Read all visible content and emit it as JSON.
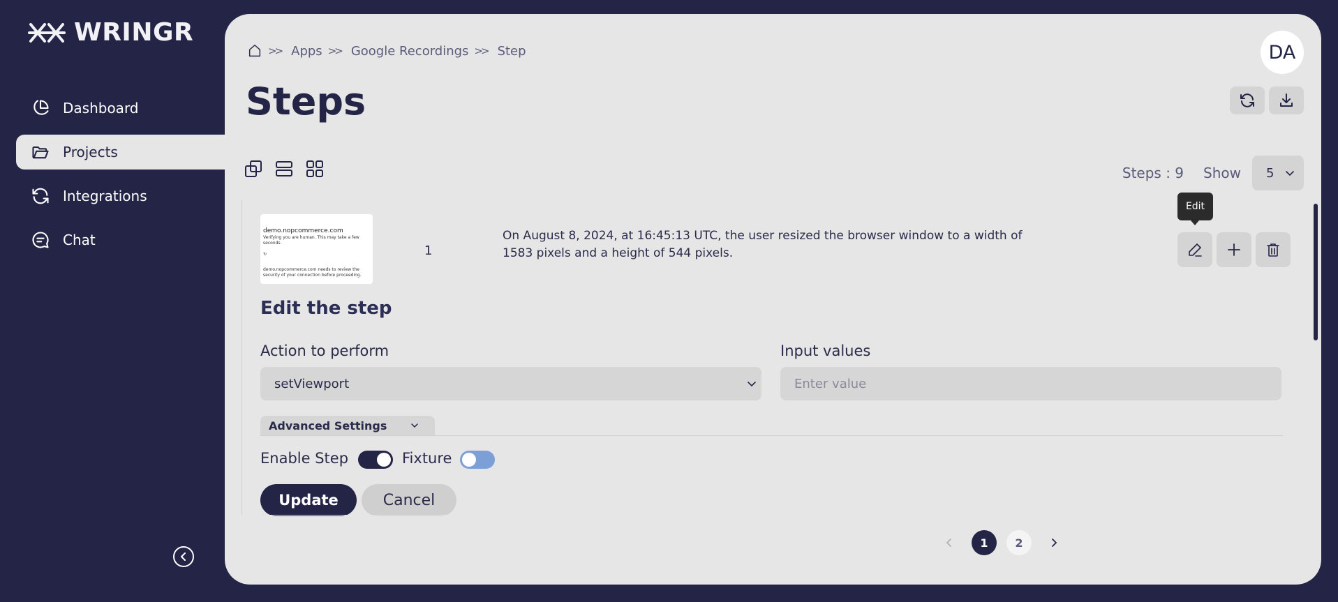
{
  "brand": {
    "name": "WRINGR"
  },
  "sidebar": {
    "items": [
      {
        "label": "Dashboard",
        "icon": "pie-chart-icon",
        "active": false
      },
      {
        "label": "Projects",
        "icon": "folder-icon",
        "active": true
      },
      {
        "label": "Integrations",
        "icon": "refresh-icon",
        "active": false
      },
      {
        "label": "Chat",
        "icon": "chat-bubble-icon",
        "active": false
      }
    ],
    "collapse_icon": "chevron-left-circle-icon"
  },
  "header": {
    "breadcrumb": [
      "Apps",
      "Google Recordings",
      "Step"
    ],
    "avatar": "DA",
    "title": "Steps"
  },
  "toolbar": {
    "steps_count": "Steps : 9",
    "show_label": "Show",
    "show_value": "5"
  },
  "step": {
    "number": "1",
    "thumbnail": {
      "site": "demo.nopcommerce.com",
      "line1": "Verifying you are human. This may take a few seconds.",
      "line2": "demo.nopcommerce.com needs to review the security of your connection before proceeding."
    },
    "description": "On August 8, 2024, at 16:45:13 UTC, the user resized the browser window to a width of 1583 pixels and a height of 544 pixels.",
    "tooltip": "Edit"
  },
  "edit_form": {
    "title": "Edit the step",
    "action_label": "Action to perform",
    "action_value": "setViewport",
    "input_label": "Input values",
    "input_placeholder": "Enter value",
    "advanced_settings": "Advanced Settings",
    "enable_step_label": "Enable Step",
    "enable_step_on": true,
    "fixture_label": "Fixture",
    "fixture_on": false,
    "update_label": "Update",
    "cancel_label": "Cancel"
  },
  "pagination": {
    "pages": [
      "1",
      "2"
    ],
    "current": "1"
  },
  "colors": {
    "sidebar_bg": "#232446",
    "panel_bg": "#e6e6e6",
    "accent": "#232446",
    "fixture_toggle": "#7b9fd6"
  }
}
